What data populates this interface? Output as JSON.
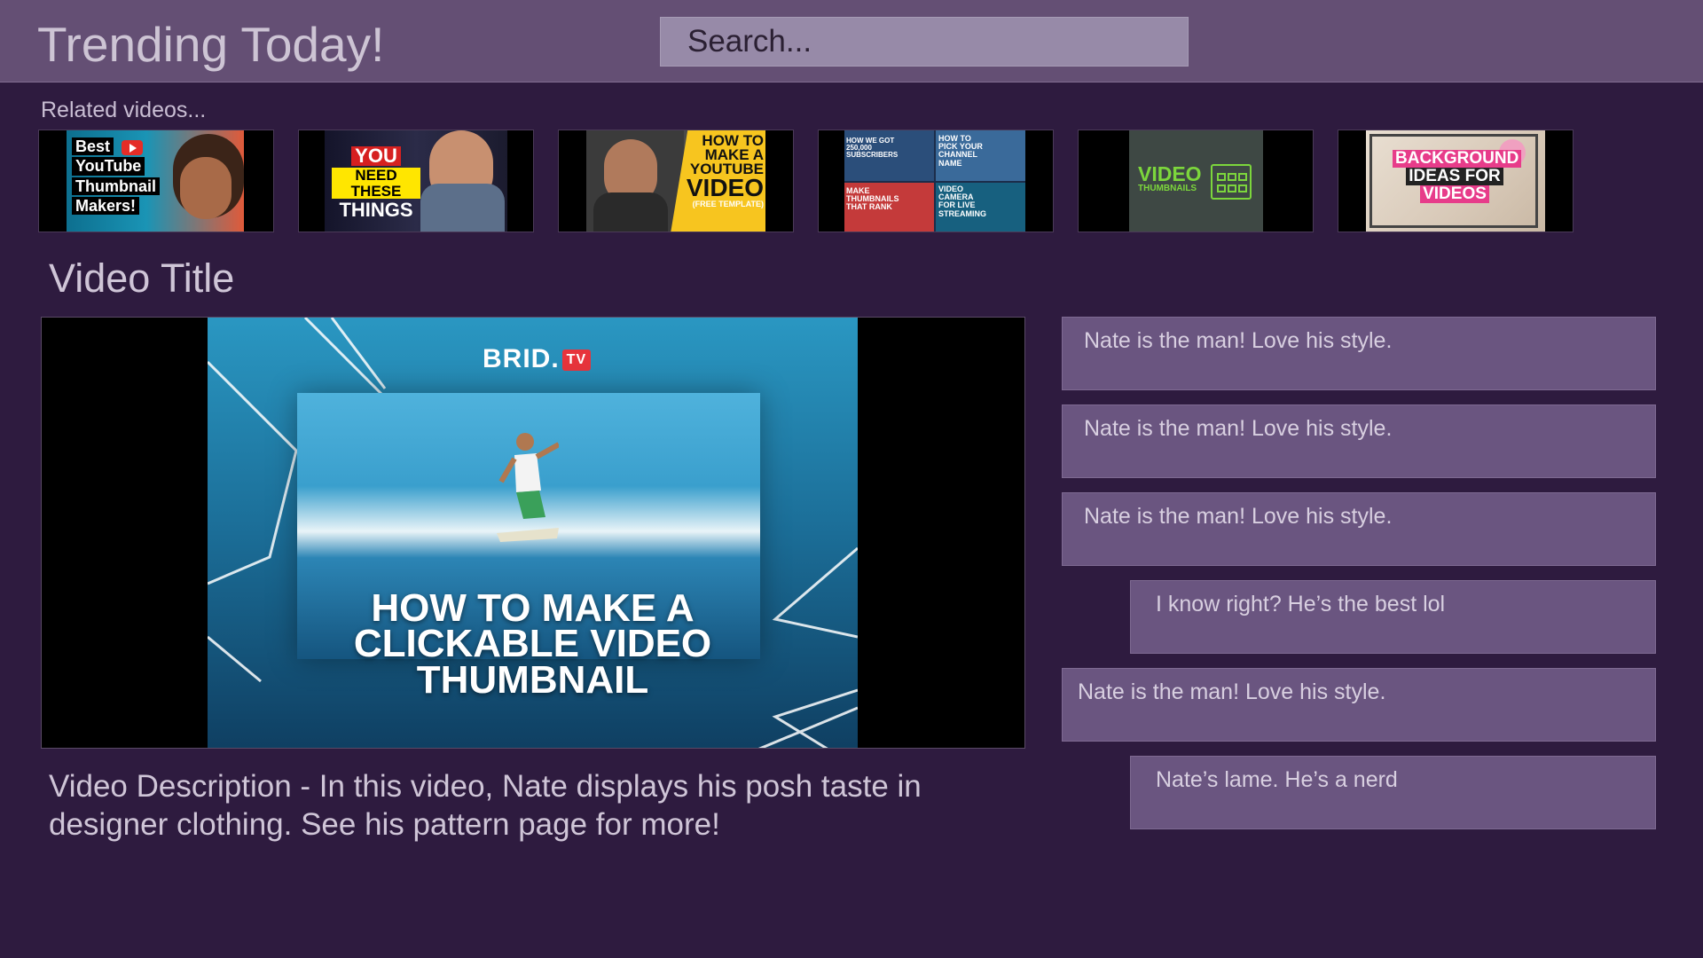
{
  "header": {
    "title": "Trending Today!",
    "search_placeholder": "Search..."
  },
  "related": {
    "label": "Related videos...",
    "thumbnails": [
      {
        "text": [
          "Best",
          "YouTube",
          "Thumbnail",
          "Makers!"
        ],
        "icon": "youtube-play-icon"
      },
      {
        "text": [
          "YOU",
          "NEED THESE",
          "THINGS"
        ]
      },
      {
        "text": [
          "HOW TO",
          "MAKE A",
          "YOUTUBE",
          "VIDEO",
          "(FREE TEMPLATE)"
        ]
      },
      {
        "text": [
          "HOW WE GOT 250,000 SUBSCRIBERS",
          "HOW TO PICK YOUR CHANNEL NAME",
          "MAKE THUMBNAILS THAT RANK",
          "VIDEO CAMERA FOR LIVE STREAMING"
        ]
      },
      {
        "text": [
          "VIDEO",
          "THUMBNAILS"
        ],
        "icon": "grid-icon"
      },
      {
        "text": [
          "BACKGROUND",
          "IDEAS FOR",
          "VIDEOS"
        ]
      }
    ]
  },
  "video": {
    "title": "Video Title",
    "brand": "BRID.",
    "brand_badge": "TV",
    "headline": [
      "HOW TO MAKE A",
      "CLICKABLE VIDEO",
      "THUMBNAIL"
    ],
    "description": "Video Description - In this video, Nate displays his posh taste in designer clothing. See his pattern page for more!"
  },
  "comments": [
    {
      "text": "Nate is the man! Love his style.",
      "reply": false
    },
    {
      "text": "Nate is the man! Love his style.",
      "reply": false
    },
    {
      "text": "Nate is the man! Love his style.",
      "reply": false
    },
    {
      "text": "I know right? He’s the best lol",
      "reply": true
    },
    {
      "text": "Nate is the man! Love his style.",
      "reply": false
    },
    {
      "text": "Nate’s lame. He’s a nerd",
      "reply": true
    }
  ]
}
